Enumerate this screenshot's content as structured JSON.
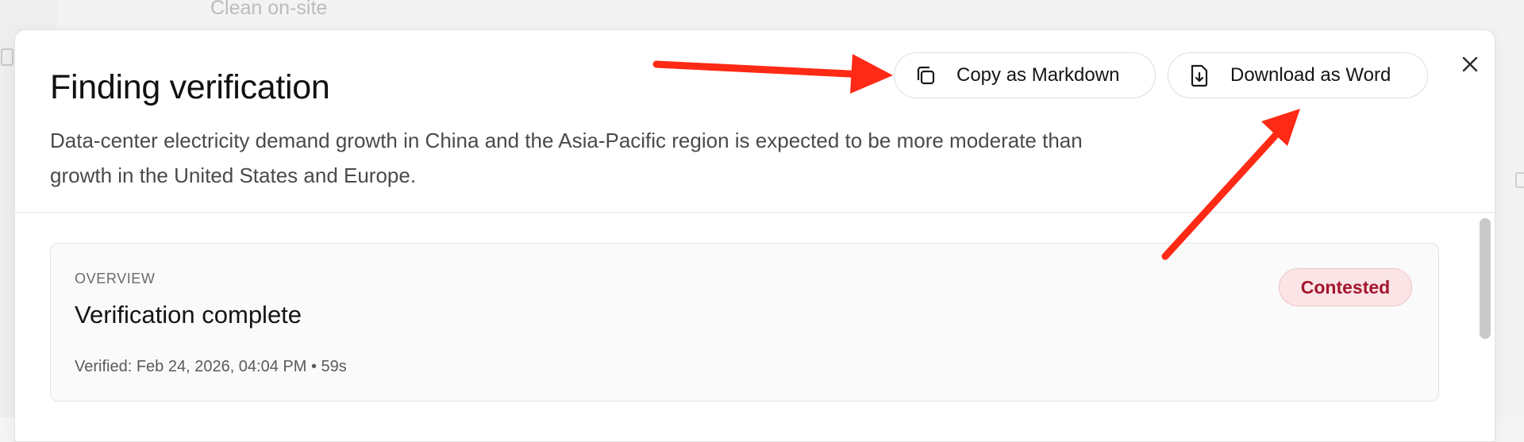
{
  "background": {
    "peek_text": "Clean on-site"
  },
  "modal": {
    "title": "Finding verification",
    "description": "Data-center electricity demand growth in China and the Asia-Pacific region is expected to be more moderate than growth in the United States and Europe.",
    "copy_button": {
      "label": "Copy as Markdown",
      "icon": "copy-icon"
    },
    "download_button": {
      "label": "Download as Word",
      "icon": "file-download-icon"
    },
    "close_icon": "close-icon"
  },
  "overview": {
    "label": "OVERVIEW",
    "title": "Verification complete",
    "meta": "Verified: Feb 24, 2026, 04:04 PM • 59s",
    "status": "Contested"
  },
  "colors": {
    "annotation_arrow": "#ff2a16",
    "status_bg": "#fbe4e6",
    "status_text": "#a3172e"
  }
}
